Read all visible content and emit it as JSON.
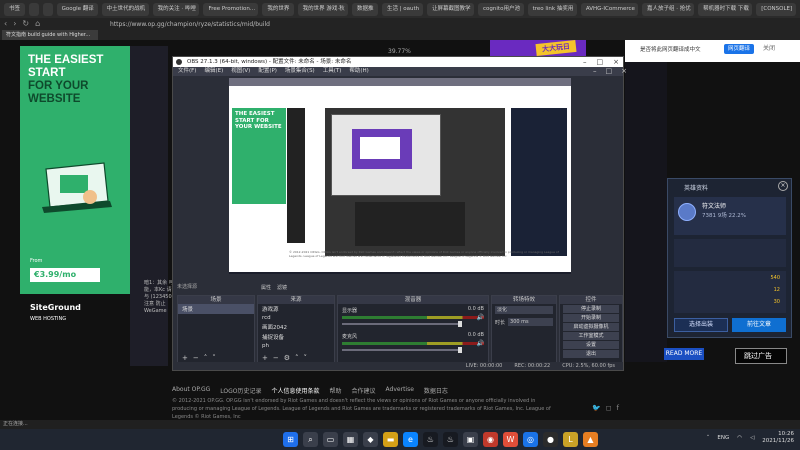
{
  "bookmarks": [
    "书签",
    "",
    "",
    "Google 翻译",
    "中土世代的战机",
    "我的关注 · 哔哩",
    "Free Promotion...",
    "我的世界",
    "我的世界 游戏·秋",
    "数据推",
    "生活 | oauth",
    "让屏幕截图教学",
    "cognito用户池",
    "treo link 抽奖用",
    "AVHG-ICommerce",
    "嘉人放子组 · 抢优",
    "帮机器时下载 下载",
    "[CONSOLE]"
  ],
  "browser": {
    "url": "https://www.op.gg/champion/ryze/statistics/mid/build",
    "active_tab": "符文指南 build guide with Higher..."
  },
  "page": {
    "ad_left": {
      "line1": "THE EASIEST",
      "line2": "START",
      "line3": "FOR YOUR",
      "line4": "WEBSITE",
      "from": "From",
      "price": "€3.99/mo",
      "brand": "SiteGround",
      "sub": "WEB HOSTING"
    },
    "stat_pct": "39.77%",
    "top_ad_text": "大大玩日",
    "translate": {
      "prompt": "是否将此网页翻译成中文",
      "button": "网页翻译",
      "close": "关闭"
    },
    "left_notes": "暗1：其余 可能，本Kc 请与 (123450) 注意 防止 WeGame",
    "game_panel": {
      "title": "英雄资料",
      "name": "符文法师",
      "stats": "7381   9场   22.2%",
      "rows": [
        [
          "",
          "540"
        ],
        [
          "",
          "12"
        ],
        [
          "",
          "30"
        ]
      ],
      "btn_left": "选择出装",
      "btn_right": "前往文章",
      "close": "×"
    },
    "skip_ad": "跳过广告",
    "read_more": "READ MORE",
    "footer": {
      "links": [
        "About OP.GG",
        "LOGO历史记录",
        "个人信息使用条款",
        "帮助",
        "合作建议",
        "Advertise",
        "数据日志"
      ],
      "copy": "© 2012-2021 OP.GG. OP.GG isn't endorsed by Riot Games and doesn't reflect the views or opinions of Riot Games or anyone officially involved in producing or managing League of Legends. League of Legends and Riot Games are trademarks or registered trademarks of Riot Games, Inc. League of Legends © Riot Games, Inc"
    },
    "status_text": "正在连接..."
  },
  "obs": {
    "title": "OBS 27.1.3 (64-bit, windows) - 配置文件: 未命名 - 场景: 未命名",
    "menu": [
      "文件(F)",
      "编辑(E)",
      "视图(V)",
      "配置(P)",
      "场景集合(S)",
      "工具(T)",
      "帮助(H)"
    ],
    "preview_ad": "THE EASIEST START FOR YOUR WEBSITE",
    "scene_btns": [
      "属性",
      "滤镜"
    ],
    "scene_label": "未选择源",
    "docks": {
      "scenes": {
        "header": "场景",
        "items": [
          "场景"
        ]
      },
      "sources": {
        "header": "来源",
        "items": [
          "游戏源",
          "rcd",
          "画面2042",
          "捕捉设备",
          "ph",
          "图像"
        ]
      },
      "mixer": {
        "header": "混音器",
        "ch1": "显示器",
        "ch1_db": "0.0 dB",
        "ch2": "麦克风",
        "ch2_db": "0.0 dB"
      },
      "transitions": {
        "header": "转场特效",
        "type": "淡化",
        "duration_label": "时长",
        "duration": "300 ms"
      },
      "controls": {
        "header": "控件",
        "buttons": [
          "停止录制",
          "开始录制",
          "启动虚拟摄像机",
          "工作室模式",
          "设置",
          "退出"
        ]
      }
    },
    "status": [
      "LIVE: 00:00:00",
      "REC: 00:00:22",
      "CPU: 2.5%, 60.00 fps"
    ]
  },
  "taskbar": {
    "lang": "ENG",
    "time": "10:26",
    "date": "2021/11/26"
  }
}
